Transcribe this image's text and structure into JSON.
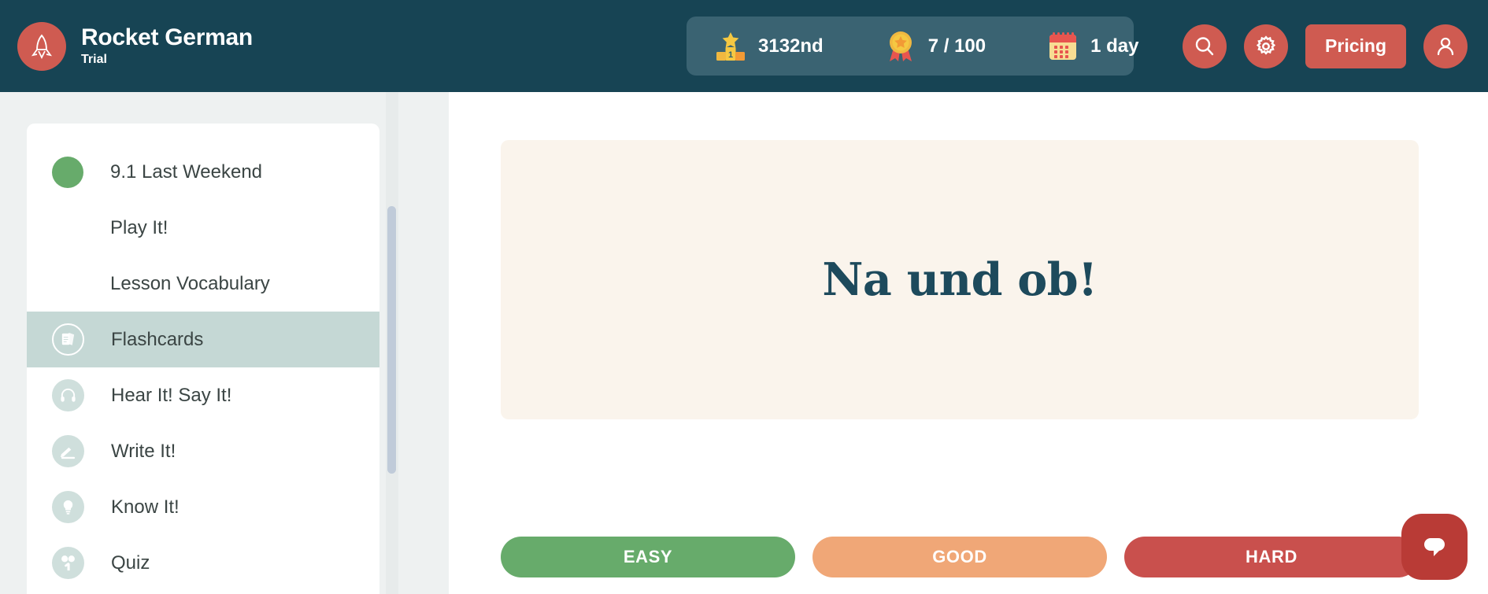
{
  "header": {
    "brand": {
      "title": "Rocket German",
      "subtitle": "Trial",
      "logo_icon": "rocket-icon"
    },
    "stats": [
      {
        "icon": "podium-rank-icon",
        "value": "3132nd"
      },
      {
        "icon": "medal-icon",
        "value": "7 / 100"
      },
      {
        "icon": "calendar-icon",
        "value": "1 day"
      }
    ],
    "actions": {
      "search_icon": "search-icon",
      "settings_icon": "gear-icon",
      "pricing_label": "Pricing",
      "account_icon": "user-icon"
    },
    "colors": {
      "bar": "#174454",
      "pill": "#3a6372",
      "accent": "#cf5b51"
    }
  },
  "sidebar": {
    "items": [
      {
        "label": "9.1 Last Weekend",
        "icon": "green-dot-icon",
        "type": "lesson",
        "active": false
      },
      {
        "label": "Play It!",
        "icon": "",
        "type": "sub",
        "active": false
      },
      {
        "label": "Lesson Vocabulary",
        "icon": "",
        "type": "sub",
        "active": false
      },
      {
        "label": "Flashcards",
        "icon": "flashcards-icon",
        "type": "tool",
        "active": true
      },
      {
        "label": "Hear It! Say It!",
        "icon": "headphones-icon",
        "type": "tool",
        "active": false
      },
      {
        "label": "Write It!",
        "icon": "writing-hand-icon",
        "type": "tool",
        "active": false
      },
      {
        "label": "Know It!",
        "icon": "lightbulb-icon",
        "type": "tool",
        "active": false
      },
      {
        "label": "Quiz",
        "icon": "quiz-hand-icon",
        "type": "tool",
        "active": false
      }
    ],
    "active_color": "#c5d8d5",
    "lesson_dot_color": "#67ab6b"
  },
  "main": {
    "flashcard": {
      "text": "Na und ob!",
      "background": "#faf4ec",
      "text_color": "#1d4a5c"
    },
    "ratings": [
      {
        "label": "EASY",
        "color": "#67ab6b"
      },
      {
        "label": "GOOD",
        "color": "#f0a777"
      },
      {
        "label": "HARD",
        "color": "#c9504d"
      }
    ]
  },
  "chat": {
    "icon": "chat-bubble-icon",
    "color": "#b93b36"
  }
}
